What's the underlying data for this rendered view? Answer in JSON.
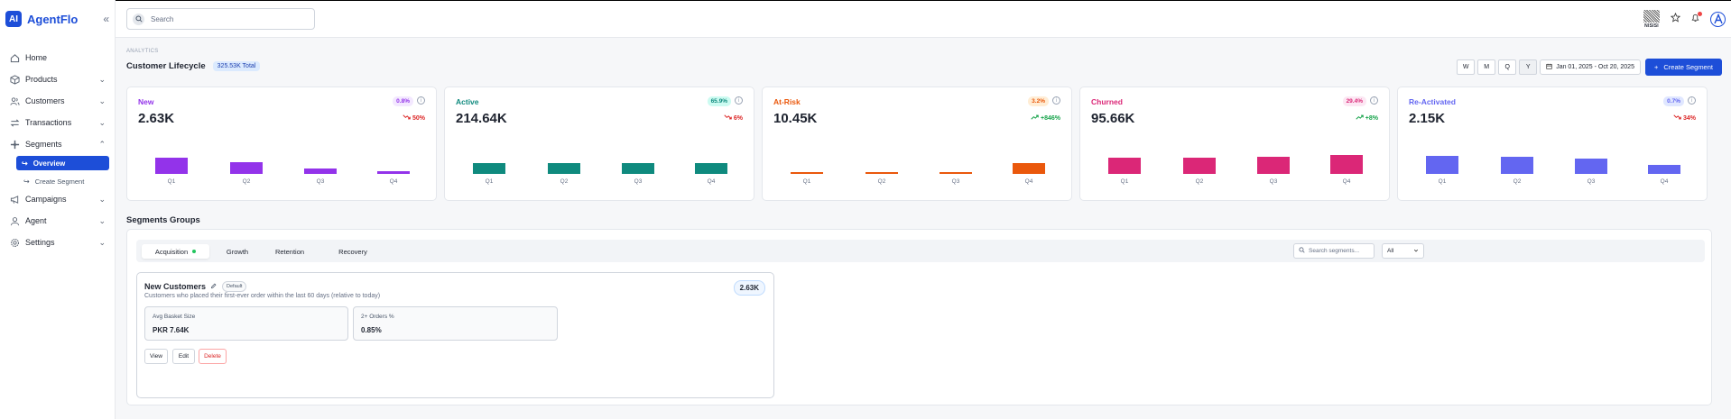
{
  "app": {
    "logo_text": "AI",
    "name": "AgentFlo",
    "collapse_glyph": "«"
  },
  "search": {
    "placeholder": "Search"
  },
  "topbar": {
    "brand_badge": "NISISI"
  },
  "sidebar": {
    "items": [
      {
        "label": "Home",
        "icon": "home-icon"
      },
      {
        "label": "Products",
        "icon": "box-icon",
        "chevron": "⌄"
      },
      {
        "label": "Customers",
        "icon": "users-icon",
        "chevron": "⌄"
      },
      {
        "label": "Transactions",
        "icon": "transfer-icon",
        "chevron": "⌄"
      },
      {
        "label": "Segments",
        "icon": "segments-icon",
        "chevron": "⌃"
      },
      {
        "label": "Campaigns",
        "icon": "megaphone-icon",
        "chevron": "⌄"
      },
      {
        "label": "Agent",
        "icon": "user-icon",
        "chevron": "⌄"
      },
      {
        "label": "Settings",
        "icon": "gear-icon",
        "chevron": "⌄"
      }
    ],
    "sub": [
      {
        "label": "Overview"
      },
      {
        "label": "Create Segment"
      }
    ]
  },
  "page": {
    "breadcrumb": "ANALYTICS",
    "title": "Customer Lifecycle",
    "total_badge": "325.53K Total"
  },
  "controls": {
    "periods": [
      "W",
      "M",
      "Q",
      "Y"
    ],
    "selected_period": "Y",
    "date_range": "Jan 01, 2025 - Oct 20, 2025",
    "create_label": "Create Segment"
  },
  "cards": [
    {
      "label": "New",
      "pct": "0.8%",
      "value": "2.63K",
      "trend": "50%",
      "direction": "down",
      "color": "#9333ea",
      "pct_bg": "#f3e8ff",
      "quarters": [
        "Q1",
        "Q2",
        "Q3",
        "Q4"
      ],
      "bar_levels": [
        0.52,
        0.38,
        0.17,
        0.1
      ]
    },
    {
      "label": "Active",
      "pct": "65.9%",
      "value": "214.64K",
      "trend": "6%",
      "direction": "down",
      "color": "#0f8a7e",
      "pct_bg": "#ccfbf1",
      "quarters": [
        "Q1",
        "Q2",
        "Q3",
        "Q4"
      ],
      "bar_levels": [
        0.36,
        0.36,
        0.36,
        0.34
      ]
    },
    {
      "label": "At-Risk",
      "pct": "3.2%",
      "value": "10.45K",
      "trend": "+846%",
      "direction": "up",
      "color": "#ea580c",
      "pct_bg": "#ffedd5",
      "quarters": [
        "Q1",
        "Q2",
        "Q3",
        "Q4"
      ],
      "bar_levels": [
        0.05,
        0.05,
        0.06,
        0.36
      ]
    },
    {
      "label": "Churned",
      "pct": "29.4%",
      "value": "95.66K",
      "trend": "+8%",
      "direction": "up",
      "color": "#db2777",
      "pct_bg": "#fce7f3",
      "quarters": [
        "Q1",
        "Q2",
        "Q3",
        "Q4"
      ],
      "bar_levels": [
        0.54,
        0.54,
        0.57,
        0.61
      ]
    },
    {
      "label": "Re-Activated",
      "pct": "0.7%",
      "value": "2.15K",
      "trend": "34%",
      "direction": "down",
      "color": "#6366f1",
      "pct_bg": "#e0e7ff",
      "quarters": [
        "Q1",
        "Q2",
        "Q3",
        "Q4"
      ],
      "bar_levels": [
        0.6,
        0.56,
        0.5,
        0.3
      ]
    }
  ],
  "groups": {
    "title": "Segments Groups",
    "tabs": [
      "Acquisition",
      "Growth",
      "Retention",
      "Recovery"
    ],
    "active_tab": "Acquisition",
    "search_placeholder": "Search segments...",
    "filter_value": "All"
  },
  "segment": {
    "name": "New Customers",
    "tag": "Default",
    "description": "Customers who placed their first-ever order within the last 60 days (relative to today)",
    "count": "2.63K",
    "metrics": [
      {
        "label": "Avg Basket Size",
        "value": "PKR 7.64K"
      },
      {
        "label": "2+ Orders %",
        "value": "0.85%"
      }
    ],
    "actions": {
      "view": "View",
      "edit": "Edit",
      "delete": "Delete"
    }
  }
}
